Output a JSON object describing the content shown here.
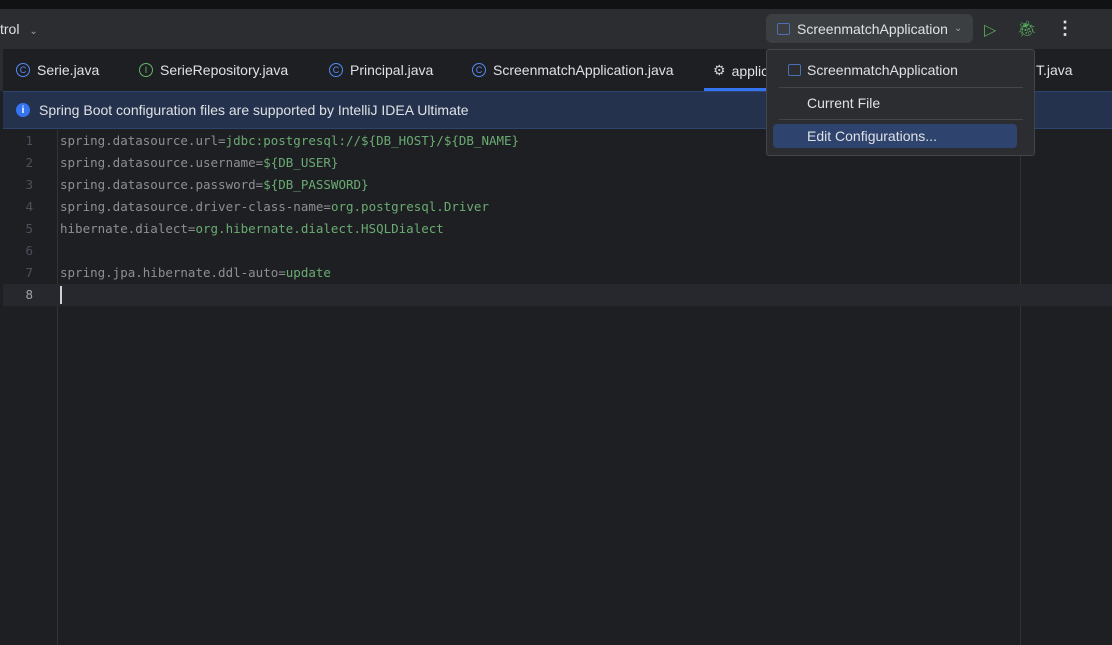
{
  "toolbar": {
    "project_label": "trol",
    "run_config": "ScreenmatchApplication"
  },
  "tabs": [
    {
      "label": "Serie.java",
      "icon": "class-icon",
      "glyph": "C"
    },
    {
      "label": "SerieRepository.java",
      "icon": "interface-icon",
      "glyph": "I"
    },
    {
      "label": "Principal.java",
      "icon": "class-icon",
      "glyph": "C"
    },
    {
      "label": "ScreenmatchApplication.java",
      "icon": "class-icon",
      "glyph": "C"
    },
    {
      "label": "applic",
      "icon": "gear-icon",
      "glyph": "⚙"
    },
    {
      "label": "T.java"
    }
  ],
  "banner": {
    "text": "Spring Boot configuration files are supported by IntelliJ IDEA Ultimate",
    "icon": "i"
  },
  "editor": {
    "lines": [
      {
        "n": "1",
        "k": "spring.datasource.url=",
        "v": "jdbc:postgresql://${DB_HOST}/${DB_NAME}"
      },
      {
        "n": "2",
        "k": "spring.datasource.username=",
        "v": "${DB_USER}"
      },
      {
        "n": "3",
        "k": "spring.datasource.password=",
        "v": "${DB_PASSWORD}"
      },
      {
        "n": "4",
        "k": "spring.datasource.driver-class-name=",
        "v": "org.postgresql.Driver"
      },
      {
        "n": "5",
        "k": "hibernate.dialect=",
        "v": "org.hibernate.dialect.HSQLDialect"
      },
      {
        "n": "6",
        "k": "",
        "v": ""
      },
      {
        "n": "7",
        "k": "spring.jpa.hibernate.ddl-auto=",
        "v": "update"
      },
      {
        "n": "8",
        "k": "",
        "v": ""
      }
    ]
  },
  "popup": {
    "items": [
      "ScreenmatchApplication",
      "Current File",
      "Edit Configurations..."
    ]
  },
  "colors": {
    "accent": "#3574f0",
    "value": "#6aab73",
    "banner": "#25324d"
  }
}
